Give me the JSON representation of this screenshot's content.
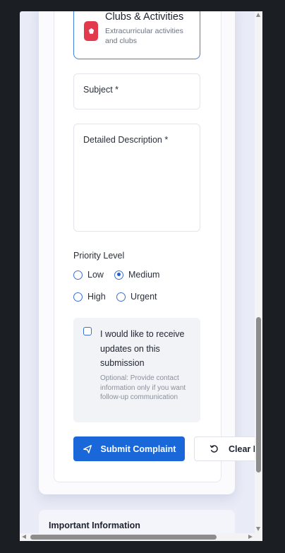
{
  "category": {
    "title": "Clubs & Activities",
    "description": "Extracurricular activities and clubs",
    "icon": "puzzle-icon",
    "icon_color": "#e23a4c"
  },
  "form": {
    "subject_placeholder": "Subject *",
    "description_placeholder": "Detailed Description *",
    "priority": {
      "label": "Priority Level",
      "options": [
        "Low",
        "Medium",
        "High",
        "Urgent"
      ],
      "selected": "Medium"
    },
    "updates": {
      "label": "I would like to receive updates on this submission",
      "hint": "Optional: Provide contact information only if you want follow-up communication",
      "checked": false
    },
    "submit_label": "Submit Complaint",
    "clear_label": "Clear F"
  },
  "info": {
    "title": "Important Information"
  },
  "colors": {
    "accent": "#1967d9",
    "selected_border": "#3f7fe0"
  }
}
